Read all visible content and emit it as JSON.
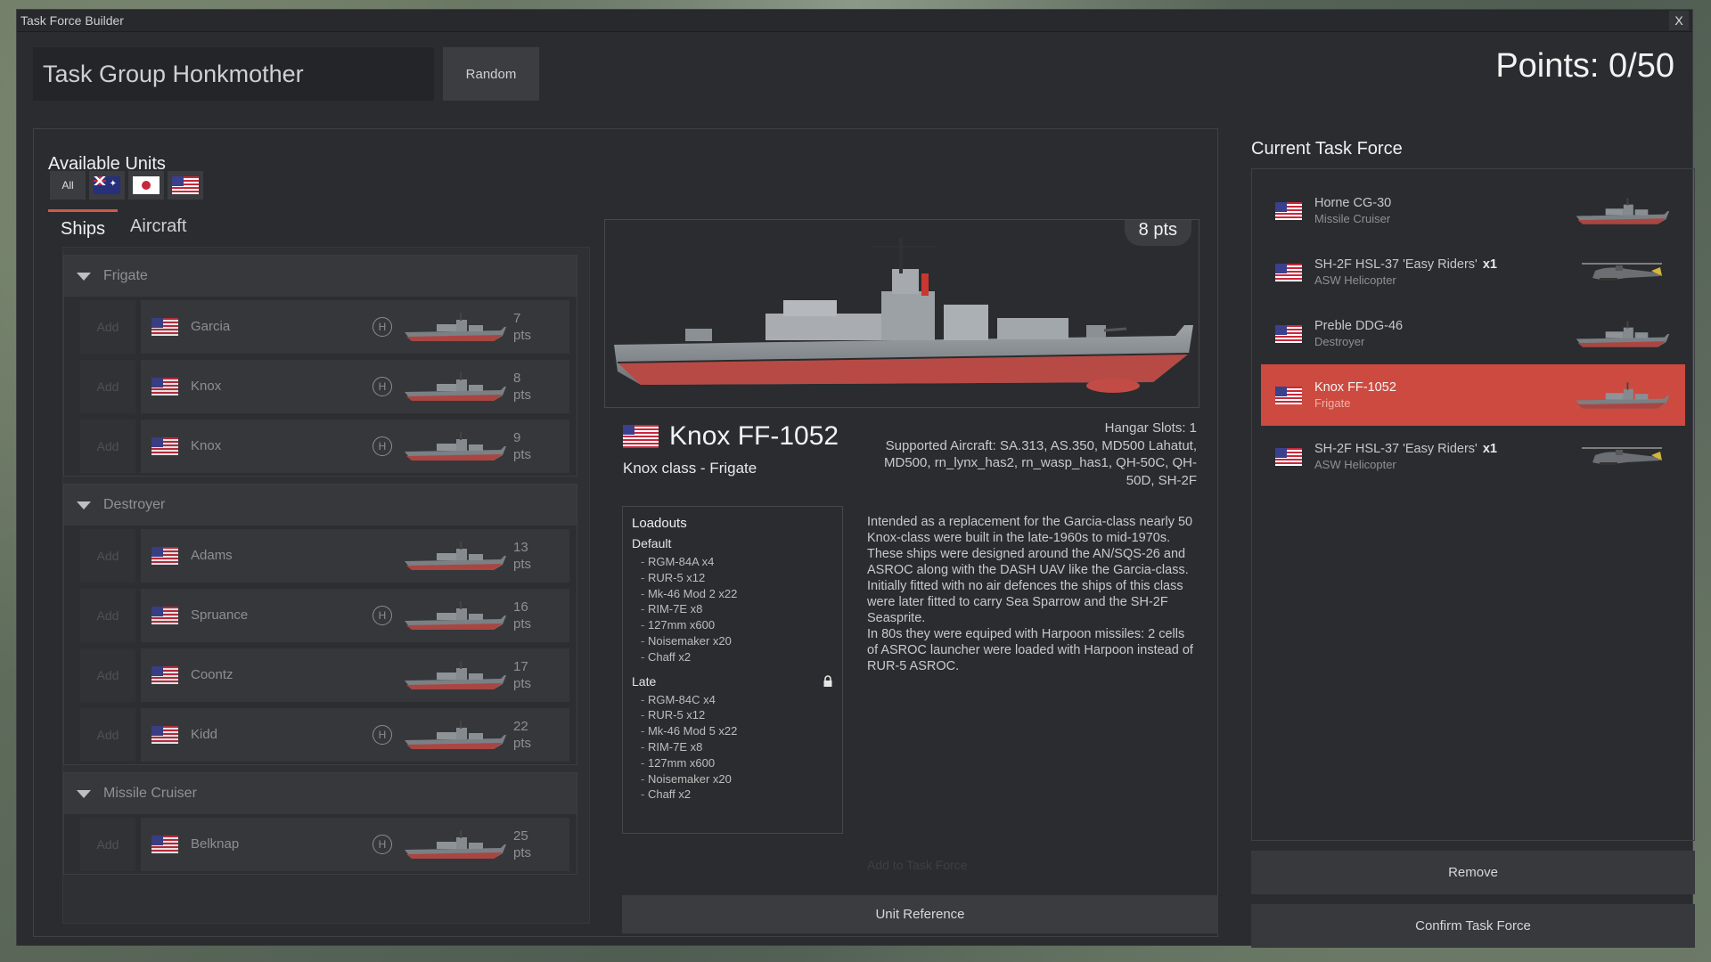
{
  "window": {
    "title": "Task Force Builder",
    "close_label": "X"
  },
  "header": {
    "task_group_name": "Task Group Honkmother",
    "random_label": "Random",
    "points": "Points: 0/50"
  },
  "available_units": {
    "title": "Available Units",
    "filters": [
      {
        "label": "All",
        "flag": ""
      },
      {
        "label": "",
        "flag": "au"
      },
      {
        "label": "",
        "flag": "jp"
      },
      {
        "label": "",
        "flag": "us"
      }
    ],
    "tabs": [
      "Ships",
      "Aircraft"
    ],
    "add_label": "Add",
    "groups": [
      {
        "name": "Frigate",
        "units": [
          {
            "name": "Garcia",
            "hangar": true,
            "pts": "7",
            "unit": "pts"
          },
          {
            "name": "Knox",
            "hangar": true,
            "pts": "8",
            "unit": "pts"
          },
          {
            "name": "Knox",
            "hangar": true,
            "pts": "9",
            "unit": "pts"
          }
        ]
      },
      {
        "name": "Destroyer",
        "units": [
          {
            "name": "Adams",
            "hangar": false,
            "pts": "13",
            "unit": "pts"
          },
          {
            "name": "Spruance",
            "hangar": true,
            "pts": "16",
            "unit": "pts"
          },
          {
            "name": "Coontz",
            "hangar": false,
            "pts": "17",
            "unit": "pts"
          },
          {
            "name": "Kidd",
            "hangar": true,
            "pts": "22",
            "unit": "pts"
          }
        ]
      },
      {
        "name": "Missile Cruiser",
        "units": [
          {
            "name": "Belknap",
            "hangar": true,
            "pts": "25",
            "unit": "pts"
          }
        ]
      }
    ]
  },
  "detail": {
    "pts_badge": "8 pts",
    "name": "Knox FF-1052",
    "class_line": "Knox class - Frigate",
    "hangar_slots": "Hangar Slots: 1",
    "supported_aircraft": "Supported Aircraft: SA.313, AS.350, MD500 Lahatut, MD500, rn_lynx_has2, rn_wasp_has1, QH-50C, QH-50D, SH-2F",
    "loadouts_title": "Loadouts",
    "default_label": "Default",
    "default_items": [
      "RGM-84A x4",
      "RUR-5 x12",
      "Mk-46 Mod 2 x22",
      "RIM-7E x8",
      "127mm x600",
      "Noisemaker x20",
      "Chaff x2"
    ],
    "late_label": "Late",
    "late_items": [
      "RGM-84C x4",
      "RUR-5 x12",
      "Mk-46 Mod 5 x22",
      "RIM-7E x8",
      "127mm x600",
      "Noisemaker x20",
      "Chaff x2"
    ],
    "description_1": "Intended as a replacement for the Garcia-class nearly 50 Knox-class were built in the late-1960s to mid-1970s. These ships were designed around the AN/SQS-26 and ASROC along with the DASH UAV like the Garcia-class. Initially fitted with no air defences the ships of this class were later fitted to carry Sea Sparrow and the SH-2F Seasprite.",
    "description_2": "In 80s they were equiped with Harpoon missiles: 2 cells of ASROC launcher were loaded with Harpoon instead of RUR-5 ASROC.",
    "add_to_task_force": "Add to Task Force",
    "unit_reference": "Unit Reference"
  },
  "task_force": {
    "title": "Current Task Force",
    "items": [
      {
        "name": "Horne CG-30",
        "count": "",
        "sub": "Missile Cruiser",
        "kind": "ship",
        "selected": false
      },
      {
        "name": "SH-2F HSL-37 'Easy Riders'",
        "count": "x1",
        "sub": "ASW Helicopter",
        "kind": "heli",
        "selected": false
      },
      {
        "name": "Preble DDG-46",
        "count": "",
        "sub": "Destroyer",
        "kind": "ship",
        "selected": false
      },
      {
        "name": "Knox FF-1052",
        "count": "",
        "sub": "Frigate",
        "kind": "ship",
        "selected": true
      },
      {
        "name": "SH-2F HSL-37 'Easy Riders'",
        "count": "x1",
        "sub": "ASW Helicopter",
        "kind": "heli",
        "selected": false
      }
    ],
    "remove_label": "Remove",
    "confirm_label": "Confirm Task Force"
  },
  "colors": {
    "accent": "#cc4a3f",
    "panel": "#2a2c2f",
    "button": "#3a3c40"
  }
}
